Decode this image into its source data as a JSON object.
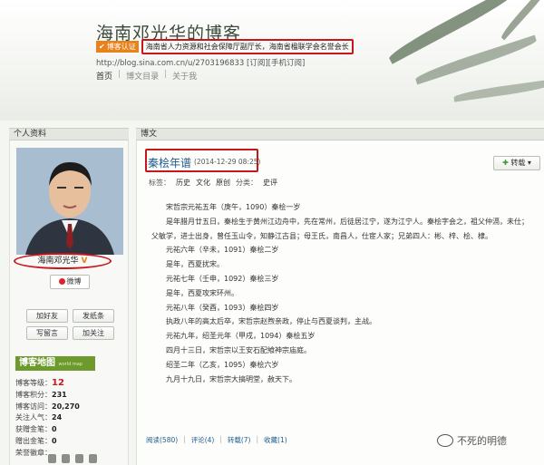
{
  "header": {
    "blog_title": "海南邓光华的博客",
    "cert_badge": "博客认证",
    "cert_text": "海南省人力资源和社会保障厅副厅长，海南省楹联学会名誉会长",
    "url": "http://blog.sina.com.cn/u/2703196833",
    "subscribe": "[订阅]",
    "mobile_subscribe": "[手机订阅]",
    "nav": [
      "首页",
      "博文目录",
      "关于我"
    ]
  },
  "sidebar": {
    "header": "个人资料",
    "name": "海南邓光华",
    "vmark": "V",
    "weibo": "微博",
    "buttons": {
      "add_friend": "加好友",
      "send_note": "发纸条",
      "message": "写留言",
      "follow": "加关注"
    },
    "blog_map": "博客地图",
    "blog_map_sub": "world map",
    "stats": {
      "level_label": "博客等级：",
      "level": "12",
      "points_label": "博客积分：",
      "points": "231",
      "visits_label": "博客访问：",
      "visits": "20,270",
      "fans_label": "关注人气：",
      "fans": "24",
      "gold_label": "获赠金笔：",
      "gold": "0",
      "given_label": "赠出金笔：",
      "given": "0",
      "honor_label": "荣誉徽章："
    }
  },
  "post": {
    "section_header": "博文",
    "title": "秦桧年谱",
    "date": "(2014-12-29 08:25)",
    "repost": "转载",
    "tags_label": "标签：",
    "tags": [
      "历史",
      "文化",
      "原创"
    ],
    "category_label": "分类：",
    "category": "史评",
    "paragraphs": [
      "宋哲宗元祐五年（庚午，1090）秦桧一岁",
      "是年腊月廿五日，秦桧生于黄州江边舟中，先在常州，后徒居江宁，遂为江宁人。秦桧字会之，祖父仲滆，未仕；父敏学，进士出身，曾任玉山令，知静江古县；母王氏，南昌人，仕宦人家；兄弟四人：彬、梓、桧、棣。",
      "元祐六年（辛未，1091）秦桧二岁",
      "是年，西夏扰宋。",
      "元祐七年（壬申，1092）秦桧三岁",
      "是年，西夏攻宋环州。",
      "元祐八年（癸酉，1093）秦桧四岁",
      "执政八年的高太后卒，宋哲宗赵煦亲政，停止与西夏谈判，主战。",
      "元祐九年，绍圣元年（甲戌，1094）秦桧五岁",
      "四月十三日，宋哲宗以王安石配飨神宗庙庭。",
      "绍圣二年（乙亥，1095）秦桧六岁",
      "九月十九日，宋哲宗大搞明堂，赦天下。"
    ],
    "footer": {
      "read": "阅读(580)",
      "comment": "评论(4)",
      "repost": "转载(7)",
      "fav": "收藏(1)"
    }
  },
  "watermark": "不死的明德"
}
